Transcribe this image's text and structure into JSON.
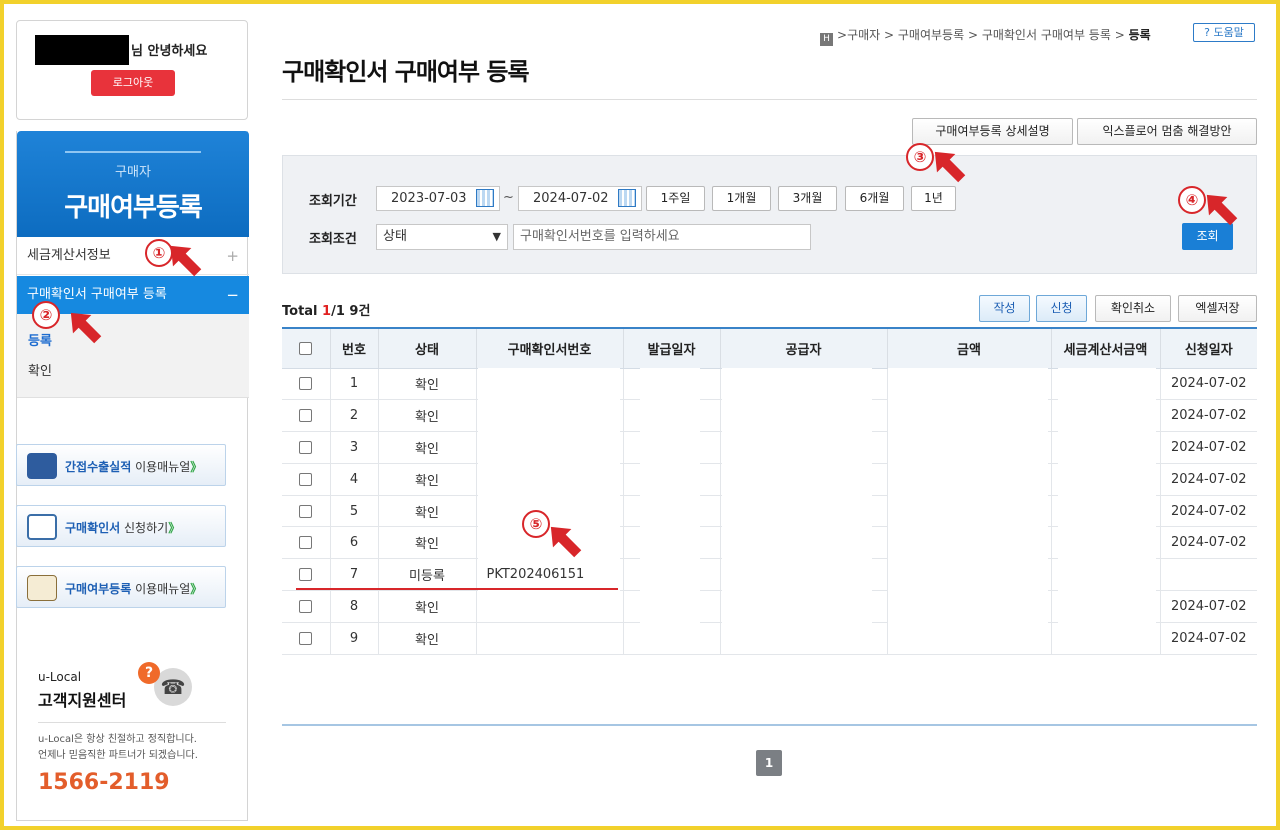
{
  "user": {
    "greeting": "님 안녕하세요",
    "logout_label": "로그아웃"
  },
  "sidebar": {
    "category": "구매자",
    "title": "구매여부등록",
    "items": [
      {
        "label": "세금계산서정보",
        "sign": "+"
      },
      {
        "label": "구매확인서 구매여부 등록",
        "sign": "−"
      }
    ],
    "subitems": [
      {
        "label": "등록"
      },
      {
        "label": "확인"
      }
    ],
    "banners": [
      {
        "strong": "간접수출실적",
        "rest": " 이용매뉴얼",
        "chevron": "》"
      },
      {
        "strong": "구매확인서",
        "rest": " 신청하기",
        "chevron": "》"
      },
      {
        "strong": "구매여부등록",
        "rest": " 이용매뉴얼",
        "chevron": "》"
      }
    ],
    "support": {
      "brand": "u-Local",
      "title": "고객지원센터",
      "desc1": "u-Local은 항상 친절하고 정직합니다.",
      "desc2": "언제나 믿음직한 파트너가 되겠습니다.",
      "phone": "1566-2119"
    }
  },
  "header": {
    "breadcrumb": [
      "구매자",
      "구매여부등록",
      "구매확인서 구매여부 등록",
      "등록"
    ],
    "help_label": "도움말",
    "title": "구매확인서 구매여부 등록",
    "detail_btn": "구매여부등록 상세설명",
    "ie_btn": "익스플로어 멈춤 해결방안"
  },
  "search": {
    "period_label": "조회기간",
    "start_date": "2023-07-03",
    "end_date": "2024-07-02",
    "tilde": "~",
    "period_buttons": [
      "1주일",
      "1개월",
      "3개월",
      "6개월",
      "1년"
    ],
    "condition_label": "조회조건",
    "status_selected": "상태",
    "input_placeholder": "구매확인서번호를 입력하세요",
    "query_btn": "조회"
  },
  "results": {
    "total_prefix": "Total ",
    "page_current": "1",
    "page_total_suffix": "/1 9건",
    "actions": [
      "작성",
      "신청",
      "확인취소",
      "엑셀저장"
    ],
    "columns": [
      "번호",
      "상태",
      "구매확인서번호",
      "발급일자",
      "공급자",
      "금액",
      "세금계산서금액",
      "신청일자"
    ],
    "rows": [
      {
        "no": "1",
        "status": "확인",
        "cert_no": "",
        "date": "2024-07-02"
      },
      {
        "no": "2",
        "status": "확인",
        "cert_no": "",
        "date": "2024-07-02"
      },
      {
        "no": "3",
        "status": "확인",
        "cert_no": "",
        "date": "2024-07-02"
      },
      {
        "no": "4",
        "status": "확인",
        "cert_no": "",
        "date": "2024-07-02"
      },
      {
        "no": "5",
        "status": "확인",
        "cert_no": "",
        "date": "2024-07-02"
      },
      {
        "no": "6",
        "status": "확인",
        "cert_no": "",
        "date": "2024-07-02"
      },
      {
        "no": "7",
        "status": "미등록",
        "cert_no": "PKT202406151",
        "date": ""
      },
      {
        "no": "8",
        "status": "확인",
        "cert_no": "",
        "date": "2024-07-02"
      },
      {
        "no": "9",
        "status": "확인",
        "cert_no": "",
        "date": "2024-07-02"
      }
    ]
  },
  "pagination": {
    "current": "1"
  },
  "annotations": [
    "①",
    "②",
    "③",
    "④",
    "⑤"
  ],
  "colors": {
    "accent": "#1a7fd6",
    "annotation": "#d8262a",
    "frame": "#f2d12b",
    "logout": "#e8333b"
  }
}
